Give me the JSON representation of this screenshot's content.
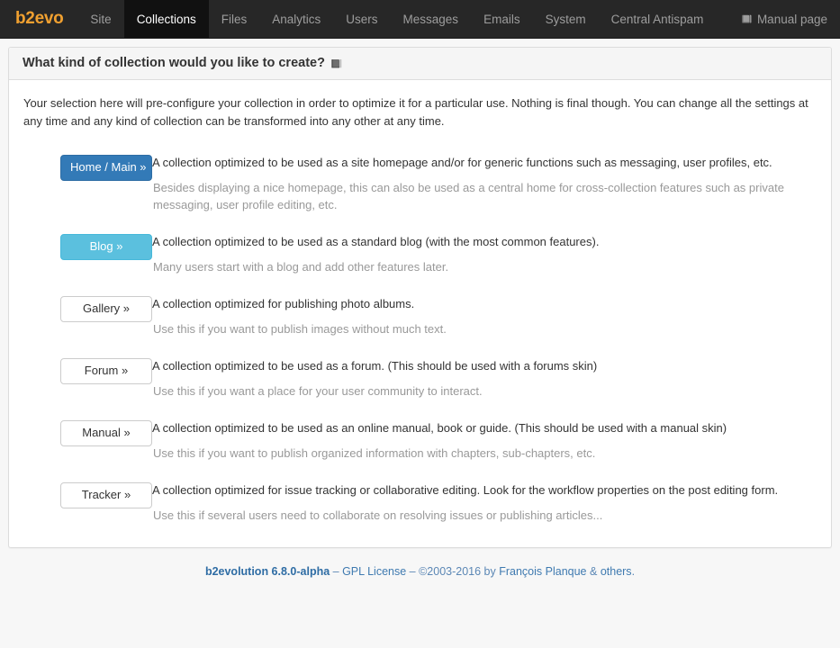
{
  "navbar": {
    "brand": "b2evo",
    "items": [
      {
        "label": "Site",
        "active": false
      },
      {
        "label": "Collections",
        "active": true
      },
      {
        "label": "Files",
        "active": false
      },
      {
        "label": "Analytics",
        "active": false
      },
      {
        "label": "Users",
        "active": false
      },
      {
        "label": "Messages",
        "active": false
      },
      {
        "label": "Emails",
        "active": false
      },
      {
        "label": "System",
        "active": false
      },
      {
        "label": "Central Antispam",
        "active": false
      }
    ],
    "manual_link": "Manual page",
    "manual_icon": "book-icon"
  },
  "panel": {
    "title": "What kind of collection would you like to create?",
    "title_icon": "book-icon",
    "intro": "Your selection here will pre-configure your collection in order to optimize it for a particular use. Nothing is final though. You can change all the settings at any time and any kind of collection can be transformed into any other at any time."
  },
  "kinds": [
    {
      "button": "Home / Main »",
      "style": "primary",
      "description": "A collection optimized to be used as a site homepage and/or for generic functions such as messaging, user profiles, etc.",
      "note": "Besides displaying a nice homepage, this can also be used as a central home for cross-collection features such as private messaging, user profile editing, etc."
    },
    {
      "button": "Blog »",
      "style": "info",
      "description": "A collection optimized to be used as a standard blog (with the most common features).",
      "note": "Many users start with a blog and add other features later."
    },
    {
      "button": "Gallery »",
      "style": "default",
      "description": "A collection optimized for publishing photo albums.",
      "note": "Use this if you want to publish images without much text."
    },
    {
      "button": "Forum »",
      "style": "default",
      "description": "A collection optimized to be used as a forum. (This should be used with a forums skin)",
      "note": "Use this if you want a place for your user community to interact."
    },
    {
      "button": "Manual »",
      "style": "default",
      "description": "A collection optimized to be used as an online manual, book or guide. (This should be used with a manual skin)",
      "note": "Use this if you want to publish organized information with chapters, sub-chapters, etc."
    },
    {
      "button": "Tracker »",
      "style": "default",
      "description": "A collection optimized for issue tracking or collaborative editing. Look for the workflow properties on the post editing form.",
      "note": "Use this if several users need to collaborate on resolving issues or publishing articles..."
    }
  ],
  "footer": {
    "version": "b2evolution 6.8.0-alpha",
    "sep1": " – ",
    "license": "GPL License",
    "sep2": " – ",
    "copyright": "©2003-2016 by ",
    "author": "François Planque",
    "amp": " & ",
    "others": "others",
    "period": "."
  },
  "colors": {
    "navbar_bg": "#272727",
    "navbar_active_bg": "#111111",
    "brand": "#ef8b1f",
    "primary": "#337ab7",
    "info": "#5bc0de",
    "page_bg": "#f7f7f7",
    "panel_head_bg": "#f5f5f5",
    "muted_text": "#999999",
    "footer_link": "#3f7ab0"
  }
}
